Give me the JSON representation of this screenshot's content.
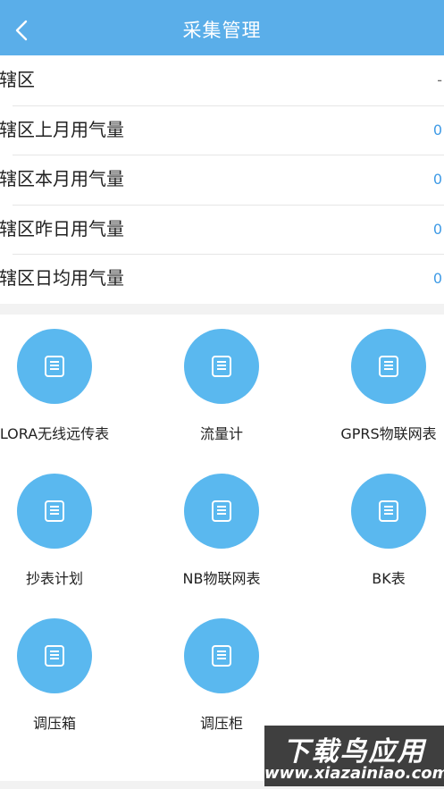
{
  "header": {
    "title": "采集管理",
    "back_icon": "chevron-left-icon",
    "bar_color": "#5aaee9"
  },
  "stats": [
    {
      "label": "辖区",
      "value": "-"
    },
    {
      "label": "辖区上月用气量",
      "value": "0"
    },
    {
      "label": "辖区本月用气量",
      "value": "0"
    },
    {
      "label": "辖区昨日用气量",
      "value": "0"
    },
    {
      "label": "辖区日均用气量",
      "value": "0"
    }
  ],
  "tiles": [
    {
      "label": "LORA无线远传表",
      "icon": "document-list-icon"
    },
    {
      "label": "流量计",
      "icon": "document-list-icon"
    },
    {
      "label": "GPRS物联网表",
      "icon": "document-list-icon"
    },
    {
      "label": "抄表计划",
      "icon": "document-list-icon"
    },
    {
      "label": "NB物联网表",
      "icon": "document-list-icon"
    },
    {
      "label": "BK表",
      "icon": "document-list-icon"
    },
    {
      "label": "调压箱",
      "icon": "document-list-icon"
    },
    {
      "label": "调压柜",
      "icon": "document-list-icon"
    }
  ],
  "watermark": {
    "title": "下载鸟应用",
    "url": "www.xiazainiao.com"
  },
  "colors": {
    "accent": "#5ab8ef",
    "value_text": "#3f9be6"
  }
}
